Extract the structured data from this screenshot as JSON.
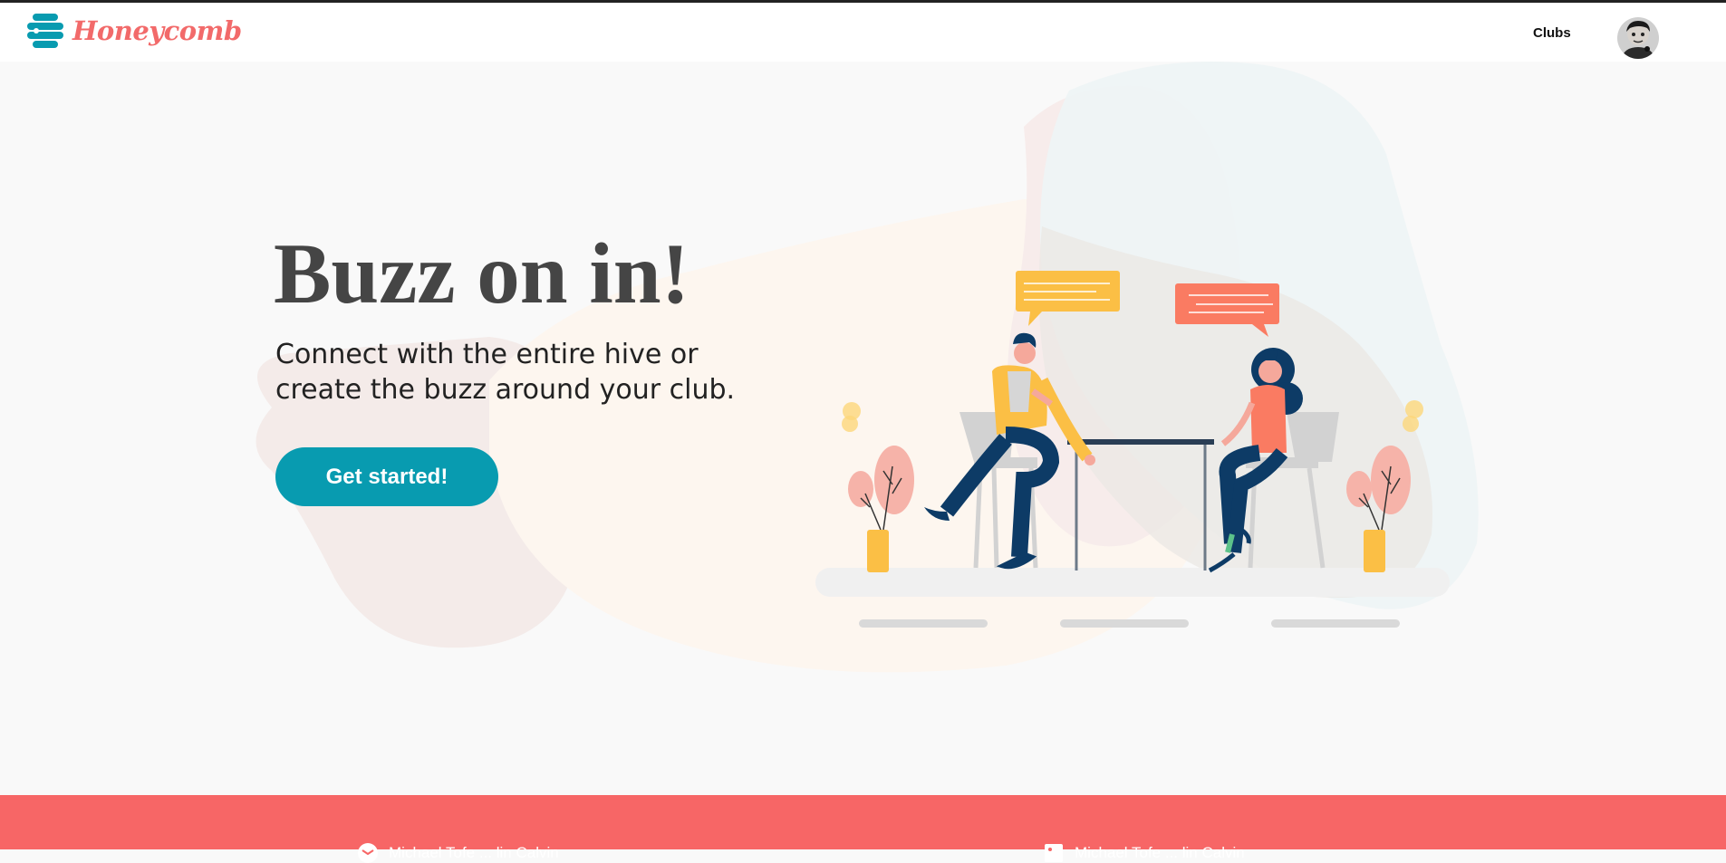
{
  "app": {
    "brand": "Honeycomb",
    "nav": {
      "clubs_label": "Clubs"
    },
    "colors": {
      "brand": "#f26a6a",
      "accent": "#089bb0",
      "footer": "#f76666",
      "text_dark": "#454545"
    }
  },
  "hero": {
    "title": "Buzz on in!",
    "subtitle_line1": "Connect with the entire hive or",
    "subtitle_line2": "create the buzz around your club.",
    "cta_label": "Get started!"
  },
  "footer": {
    "left_text": "Michael Tofe ... lin Calvin",
    "right_text": "Michael Tofe ... lin Calvin",
    "left_icon": "email-icon",
    "right_icon": "image-icon"
  }
}
